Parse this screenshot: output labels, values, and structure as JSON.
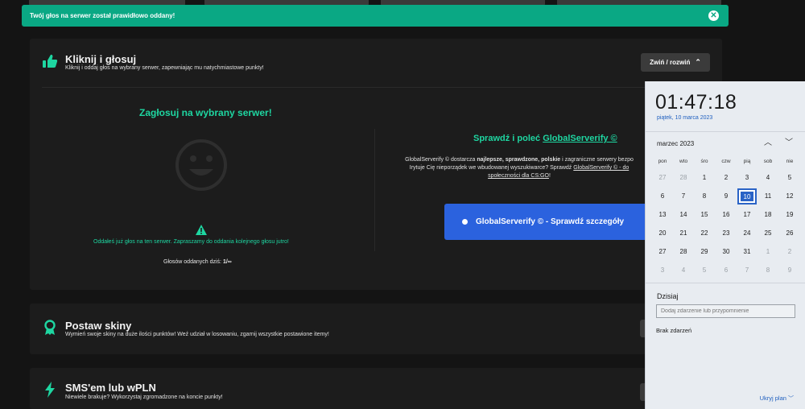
{
  "notification": {
    "text": "Twój głos na serwer został prawidłowo oddany!",
    "close_icon": "close-icon"
  },
  "vote_panel": {
    "title": "Kliknij i głosuj",
    "subtitle": "Kliknij i oddaj głos na wybrany serwer, zapewniając mu natychmiastowe punkty!",
    "toggle_label": "Zwiń / rozwiń",
    "left": {
      "title": "Zagłosuj na wybrany serwer!",
      "message": "Oddałeś już głos na ten serwer. Zapraszamy do oddania kolejnego głosu jutro!",
      "count_label": "Głosów oddanych dziś:",
      "count_value": "1/∞"
    },
    "right": {
      "title_prefix": "Sprawdź i poleć ",
      "title_link": "GlobalServerify ©",
      "desc_1a": "GlobalServerify © dostarcza ",
      "desc_1b": "najlepsze, sprawdzone, polskie",
      "desc_1c": " i zagraniczne serwery bezpo",
      "desc_2a": "Irytuje Cię nieporządek we wbudowanej wyszukiwarce? Sprawdź ",
      "desc_2b": "GlobalServerify © - do",
      "desc_3a": "społeczności dla CS:GO",
      "desc_3b": "!",
      "button_label": "GlobalServerify © - Sprawdź szczegóły"
    }
  },
  "skins_panel": {
    "title": "Postaw skiny",
    "subtitle": "Wymień swoje skiny na duże ilości punktów! Weź udział w losowaniu, zgarnij wszystkie postawione itemy!"
  },
  "sms_panel": {
    "title": "SMS'em lub wPLN",
    "subtitle": "Niewiele brakuje? Wykorzystaj zgromadzone na koncie punkty!"
  },
  "calendar": {
    "time": "01:47:18",
    "date": "piątek, 10 marca 2023",
    "month_label": "marzec 2023",
    "weekdays": [
      "pon",
      "wto",
      "śro",
      "czw",
      "pią",
      "sob",
      "nie"
    ],
    "days": [
      [
        "27",
        "28",
        "1",
        "2",
        "3",
        "4",
        "5"
      ],
      [
        "6",
        "7",
        "8",
        "9",
        "10",
        "11",
        "12"
      ],
      [
        "13",
        "14",
        "15",
        "16",
        "17",
        "18",
        "19"
      ],
      [
        "20",
        "21",
        "22",
        "23",
        "24",
        "25",
        "26"
      ],
      [
        "27",
        "28",
        "29",
        "30",
        "31",
        "1",
        "2"
      ],
      [
        "3",
        "4",
        "5",
        "6",
        "7",
        "8",
        "9"
      ]
    ],
    "today_label": "Dzisiaj",
    "event_placeholder": "Dodaj zdarzenie lub przypomnienie",
    "no_events": "Brak zdarzeń",
    "hide_plan": "Ukryj plan"
  },
  "colors": {
    "accent_green": "#1ed6a1",
    "notify_green": "#0aa884",
    "button_blue": "#2b62de",
    "today_blue": "#2a63c6"
  }
}
